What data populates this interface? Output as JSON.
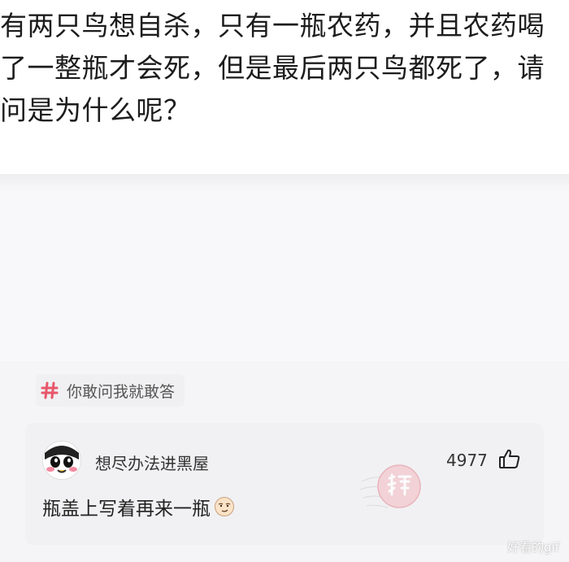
{
  "question": {
    "text": "有两只鸟想自杀，只有一瓶农药，并且农药喝了一整瓶才会死，但是最后两只鸟都死了，请问是为什么呢？"
  },
  "topic": {
    "icon": "hash-icon",
    "label": "你敢问我就敢答",
    "accent_color": "#e8576b"
  },
  "comment": {
    "avatar_icon": "panda-avatar",
    "username": "想尽办法进黑屋",
    "like_count": "4977",
    "like_icon": "thumbs-up-icon",
    "text": "瓶盖上写着再来一瓶",
    "emoji_icon": "smirk-face-icon",
    "stamp_icon": "god-reply-stamp"
  },
  "watermark": "好看的gif"
}
